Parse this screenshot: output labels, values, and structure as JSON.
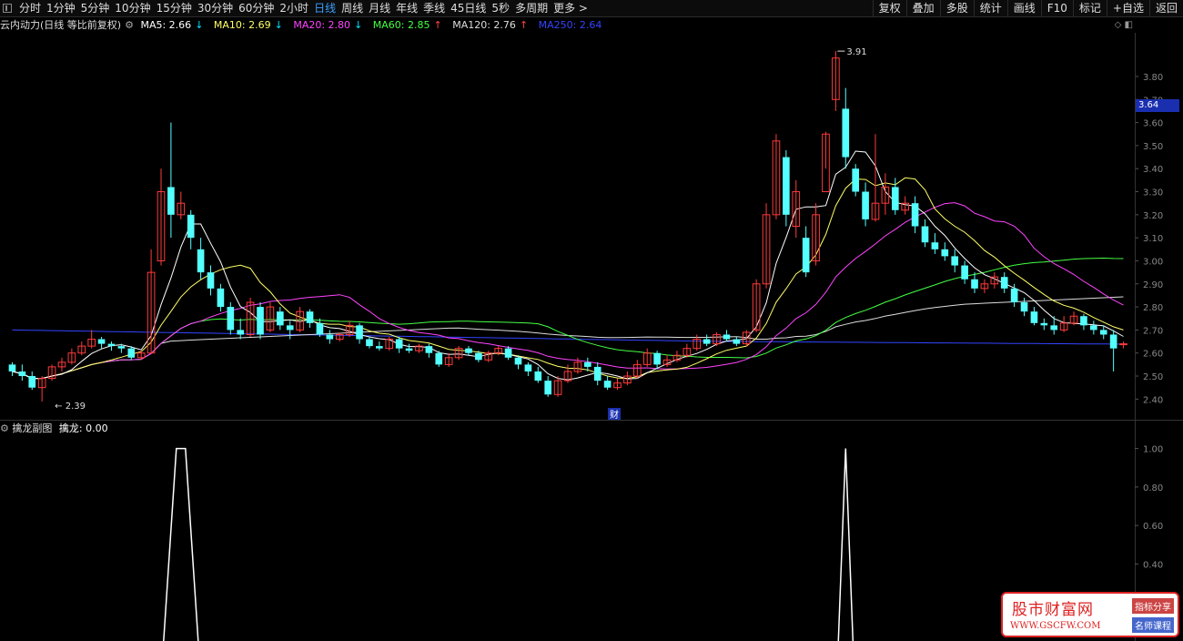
{
  "toolbar": {
    "period_tabs": [
      "分时",
      "1分钟",
      "5分钟",
      "10分钟",
      "15分钟",
      "30分钟",
      "60分钟",
      "2小时",
      "日线",
      "周线",
      "月线",
      "年线",
      "季线",
      "45日线",
      "5秒",
      "多周期",
      "更多 >"
    ],
    "active_tab": "日线",
    "right_tools": [
      "复权",
      "叠加",
      "多股",
      "统计",
      "画线",
      "F10",
      "标记",
      "+自选",
      "返回"
    ]
  },
  "legend": {
    "title": "云内动力(日线 等比前复权)",
    "ma5": "MA5: 2.66",
    "ma10": "MA10: 2.69",
    "ma20": "MA20: 2.80",
    "ma60": "MA60: 2.85",
    "ma120": "MA120: 2.76",
    "ma250": "MA250: 2.64",
    "ma5_color": "#ffffff",
    "ma10_color": "#ffff66",
    "ma20_color": "#ff44ff",
    "ma60_color": "#44ff44",
    "ma120_color": "#dddddd",
    "ma250_color": "#3344ff"
  },
  "price_axis": {
    "labels": [
      "3.80",
      "3.70",
      "3.60",
      "3.50",
      "3.40",
      "3.30",
      "3.20",
      "3.10",
      "3.00",
      "2.90",
      "2.80",
      "2.70",
      "2.60",
      "2.50",
      "2.40"
    ],
    "current_price": "3.64",
    "high_mark": "3.91",
    "low_mark": "2.39"
  },
  "finance_marker": "财",
  "sub_chart": {
    "title": "擒龙副图",
    "value_label": "擒龙: 0.00",
    "axis_labels": [
      "1.00",
      "0.80",
      "0.60",
      "0.40"
    ]
  },
  "watermark": {
    "title": "股市财富网",
    "url": "WWW.GSCFW.COM",
    "tag1": "指标分享",
    "tag2": "名师课程"
  },
  "chart_data": {
    "type": "candlestick",
    "title": "云内动力(日线 等比前复权)",
    "ylim": [
      2.35,
      3.95
    ],
    "up_color": "#ff3b3b",
    "down_color": "#54ffff",
    "candles": [
      [
        2.55,
        2.52,
        2.56,
        2.5
      ],
      [
        2.52,
        2.5,
        2.55,
        2.48
      ],
      [
        2.5,
        2.45,
        2.52,
        2.44
      ],
      [
        2.45,
        2.49,
        2.5,
        2.39
      ],
      [
        2.49,
        2.54,
        2.55,
        2.48
      ],
      [
        2.54,
        2.56,
        2.58,
        2.52
      ],
      [
        2.56,
        2.6,
        2.62,
        2.55
      ],
      [
        2.6,
        2.63,
        2.65,
        2.59
      ],
      [
        2.63,
        2.66,
        2.7,
        2.62
      ],
      [
        2.66,
        2.64,
        2.67,
        2.62
      ],
      [
        2.64,
        2.63,
        2.65,
        2.61
      ],
      [
        2.63,
        2.62,
        2.64,
        2.6
      ],
      [
        2.62,
        2.58,
        2.63,
        2.57
      ],
      [
        2.58,
        2.6,
        2.61,
        2.57
      ],
      [
        2.6,
        2.95,
        3.05,
        2.6
      ],
      [
        3.0,
        3.3,
        3.4,
        2.98
      ],
      [
        3.32,
        3.2,
        3.6,
        3.1
      ],
      [
        3.2,
        3.25,
        3.3,
        3.18
      ],
      [
        3.2,
        3.1,
        3.22,
        3.05
      ],
      [
        3.05,
        2.95,
        3.1,
        2.92
      ],
      [
        2.95,
        2.88,
        2.98,
        2.85
      ],
      [
        2.88,
        2.8,
        2.9,
        2.78
      ],
      [
        2.8,
        2.7,
        2.82,
        2.68
      ],
      [
        2.7,
        2.68,
        2.75,
        2.66
      ],
      [
        2.68,
        2.82,
        2.84,
        2.67
      ],
      [
        2.8,
        2.68,
        2.82,
        2.66
      ],
      [
        2.7,
        2.8,
        2.82,
        2.69
      ],
      [
        2.78,
        2.72,
        2.8,
        2.7
      ],
      [
        2.72,
        2.7,
        2.74,
        2.66
      ],
      [
        2.7,
        2.78,
        2.8,
        2.69
      ],
      [
        2.78,
        2.73,
        2.79,
        2.71
      ],
      [
        2.73,
        2.68,
        2.75,
        2.67
      ],
      [
        2.68,
        2.66,
        2.7,
        2.64
      ],
      [
        2.66,
        2.68,
        2.69,
        2.65
      ],
      [
        2.68,
        2.72,
        2.74,
        2.67
      ],
      [
        2.72,
        2.66,
        2.73,
        2.64
      ],
      [
        2.66,
        2.63,
        2.67,
        2.62
      ],
      [
        2.63,
        2.62,
        2.65,
        2.61
      ],
      [
        2.62,
        2.66,
        2.67,
        2.61
      ],
      [
        2.66,
        2.62,
        2.67,
        2.6
      ],
      [
        2.62,
        2.61,
        2.64,
        2.6
      ],
      [
        2.61,
        2.63,
        2.64,
        2.6
      ],
      [
        2.63,
        2.6,
        2.64,
        2.58
      ],
      [
        2.6,
        2.55,
        2.61,
        2.54
      ],
      [
        2.55,
        2.58,
        2.6,
        2.54
      ],
      [
        2.58,
        2.62,
        2.63,
        2.57
      ],
      [
        2.62,
        2.6,
        2.63,
        2.59
      ],
      [
        2.6,
        2.57,
        2.61,
        2.56
      ],
      [
        2.57,
        2.6,
        2.61,
        2.56
      ],
      [
        2.6,
        2.62,
        2.63,
        2.59
      ],
      [
        2.62,
        2.58,
        2.63,
        2.57
      ],
      [
        2.58,
        2.55,
        2.59,
        2.53
      ],
      [
        2.55,
        2.52,
        2.56,
        2.5
      ],
      [
        2.52,
        2.48,
        2.54,
        2.47
      ],
      [
        2.48,
        2.42,
        2.5,
        2.41
      ],
      [
        2.42,
        2.48,
        2.5,
        2.41
      ],
      [
        2.48,
        2.52,
        2.55,
        2.47
      ],
      [
        2.52,
        2.56,
        2.58,
        2.51
      ],
      [
        2.56,
        2.54,
        2.58,
        2.52
      ],
      [
        2.54,
        2.48,
        2.56,
        2.46
      ],
      [
        2.48,
        2.45,
        2.5,
        2.44
      ],
      [
        2.45,
        2.47,
        2.49,
        2.44
      ],
      [
        2.47,
        2.5,
        2.52,
        2.46
      ],
      [
        2.5,
        2.55,
        2.57,
        2.49
      ],
      [
        2.55,
        2.6,
        2.62,
        2.54
      ],
      [
        2.6,
        2.55,
        2.61,
        2.53
      ],
      [
        2.55,
        2.57,
        2.59,
        2.54
      ],
      [
        2.57,
        2.59,
        2.61,
        2.56
      ],
      [
        2.59,
        2.62,
        2.64,
        2.58
      ],
      [
        2.62,
        2.66,
        2.68,
        2.61
      ],
      [
        2.66,
        2.64,
        2.68,
        2.63
      ],
      [
        2.64,
        2.68,
        2.69,
        2.63
      ],
      [
        2.68,
        2.66,
        2.7,
        2.65
      ],
      [
        2.66,
        2.64,
        2.67,
        2.63
      ],
      [
        2.64,
        2.69,
        2.7,
        2.63
      ],
      [
        2.7,
        2.9,
        2.92,
        2.69
      ],
      [
        2.9,
        3.2,
        3.25,
        2.88
      ],
      [
        3.2,
        3.52,
        3.55,
        3.18
      ],
      [
        3.45,
        3.2,
        3.48,
        3.15
      ],
      [
        3.15,
        3.3,
        3.35,
        3.1
      ],
      [
        3.1,
        2.95,
        3.15,
        2.93
      ],
      [
        3.0,
        3.2,
        3.25,
        2.98
      ],
      [
        3.3,
        3.55,
        3.56,
        3.4
      ],
      [
        3.7,
        3.88,
        3.91,
        3.65
      ],
      [
        3.66,
        3.45,
        3.75,
        3.4
      ],
      [
        3.4,
        3.3,
        3.42,
        3.28
      ],
      [
        3.3,
        3.18,
        3.34,
        3.15
      ],
      [
        3.18,
        3.25,
        3.55,
        3.17
      ],
      [
        3.25,
        3.32,
        3.38,
        3.2
      ],
      [
        3.32,
        3.22,
        3.36,
        3.2
      ],
      [
        3.22,
        3.25,
        3.28,
        3.2
      ],
      [
        3.25,
        3.15,
        3.28,
        3.12
      ],
      [
        3.15,
        3.08,
        3.18,
        3.06
      ],
      [
        3.08,
        3.05,
        3.12,
        3.03
      ],
      [
        3.05,
        3.02,
        3.08,
        3.0
      ],
      [
        3.02,
        2.98,
        3.05,
        2.95
      ],
      [
        2.98,
        2.92,
        3.0,
        2.9
      ],
      [
        2.92,
        2.88,
        2.95,
        2.86
      ],
      [
        2.88,
        2.9,
        2.92,
        2.86
      ],
      [
        2.9,
        2.93,
        2.95,
        2.88
      ],
      [
        2.93,
        2.88,
        2.95,
        2.86
      ],
      [
        2.88,
        2.82,
        2.9,
        2.8
      ],
      [
        2.82,
        2.78,
        2.84,
        2.76
      ],
      [
        2.78,
        2.73,
        2.8,
        2.72
      ],
      [
        2.73,
        2.72,
        2.75,
        2.7
      ],
      [
        2.72,
        2.7,
        2.76,
        2.68
      ],
      [
        2.7,
        2.73,
        2.76,
        2.69
      ],
      [
        2.73,
        2.76,
        2.78,
        2.72
      ],
      [
        2.76,
        2.72,
        2.77,
        2.7
      ],
      [
        2.72,
        2.7,
        2.74,
        2.68
      ],
      [
        2.7,
        2.68,
        2.72,
        2.66
      ],
      [
        2.68,
        2.62,
        2.7,
        2.52
      ],
      [
        2.64,
        2.64,
        2.65,
        2.62
      ]
    ],
    "sub_series": {
      "name": "擒龙",
      "ylim": [
        0,
        1.05
      ],
      "spikes": [
        [
          17,
          1.0
        ],
        [
          84,
          1.0
        ]
      ]
    }
  }
}
